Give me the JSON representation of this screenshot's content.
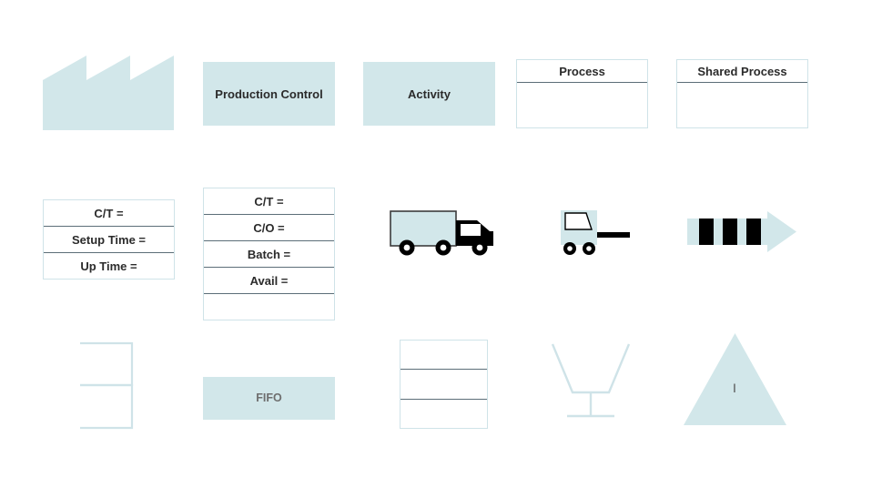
{
  "page": {
    "title": "Value Stream Mapping Shapes Stencil",
    "background_color": "#ffffff",
    "fill_color": "#d2e7ea",
    "border_color": "#cfe3e8",
    "divider_color": "#5c6e78",
    "text_color": "#2b2b2b",
    "muted_text_color": "#6e6e6e",
    "black": "#000000"
  },
  "shapes": {
    "factory": {
      "name": "External Source / Factory",
      "icon": "factory-icon"
    },
    "production_control": {
      "label": "Production Control"
    },
    "activity": {
      "label": "Activity"
    },
    "process": {
      "label": "Process"
    },
    "shared_process": {
      "label": "Shared Process"
    },
    "data_box_three": {
      "rows": [
        "C/T =",
        "Setup Time =",
        "Up Time ="
      ]
    },
    "data_box_five": {
      "rows": [
        "C/T =",
        "C/O =",
        "Batch =",
        "Avail =",
        ""
      ]
    },
    "truck": {
      "name": "Truck Shipment",
      "icon": "truck-icon"
    },
    "forklift": {
      "name": "Forklift Movement",
      "icon": "forklift-icon"
    },
    "push_arrow": {
      "name": "Push Arrow",
      "icon": "striped-arrow-icon"
    },
    "supermarket": {
      "name": "Supermarket",
      "icon": "supermarket-icon"
    },
    "fifo": {
      "label": "FIFO"
    },
    "empty_data_box": {
      "rows": [
        "",
        "",
        ""
      ]
    },
    "funnel": {
      "name": "Pull / Withdrawal Funnel",
      "icon": "funnel-icon"
    },
    "inventory_triangle": {
      "label": "I",
      "name": "Inventory Triangle",
      "icon": "triangle-icon"
    }
  }
}
